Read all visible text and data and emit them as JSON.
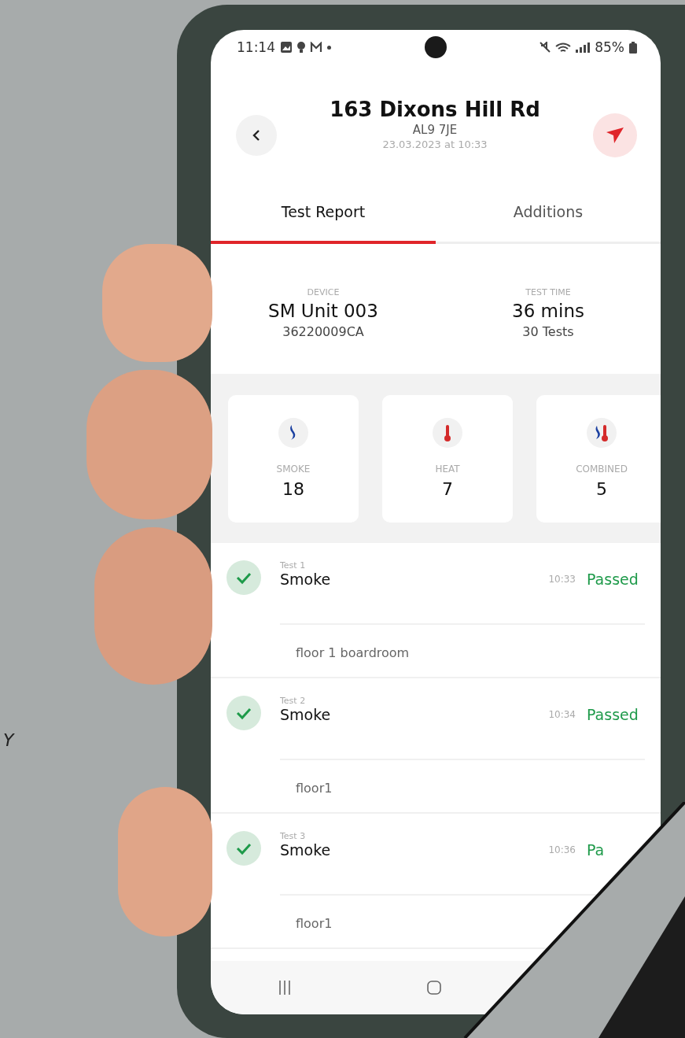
{
  "caption": "Y",
  "status_bar": {
    "time": "11:14",
    "battery": "85%"
  },
  "header": {
    "title": "163 Dixons Hill Rd",
    "postcode": "AL9 7JE",
    "date": "23.03.2023 at 10:33"
  },
  "tabs": [
    {
      "label": "Test Report",
      "selected": true
    },
    {
      "label": "Additions",
      "selected": false
    }
  ],
  "summary": [
    {
      "label": "DEVICE",
      "value": "SM Unit 003",
      "detail": "36220009CA"
    },
    {
      "label": "TEST TIME",
      "value": "36 mins",
      "detail": "30 Tests"
    }
  ],
  "categories": [
    {
      "kind": "smoke",
      "label": "SMOKE",
      "count": "18"
    },
    {
      "kind": "heat",
      "label": "HEAT",
      "count": "7"
    },
    {
      "kind": "combined",
      "label": "COMBINED",
      "count": "5"
    }
  ],
  "tests": [
    {
      "number": "Test 1",
      "type": "Smoke",
      "time": "10:33",
      "result": "Passed",
      "passed": true,
      "location": "floor 1 boardroom"
    },
    {
      "number": "Test 2",
      "type": "Smoke",
      "time": "10:34",
      "result": "Passed",
      "passed": true,
      "location": "floor1"
    },
    {
      "number": "Test 3",
      "type": "Smoke",
      "time": "10:36",
      "result": "Pa",
      "passed": true,
      "location": "floor1"
    }
  ]
}
